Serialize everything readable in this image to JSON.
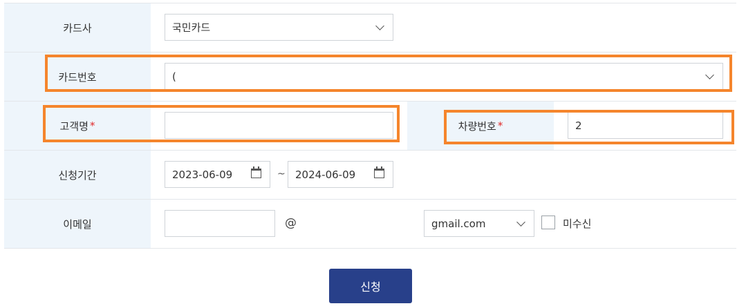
{
  "form": {
    "card_company": {
      "label": "카드사",
      "value": "국민카드"
    },
    "card_number": {
      "label": "카드번호",
      "value": "("
    },
    "customer_name": {
      "label": "고객명",
      "required_mark": "*",
      "value": ""
    },
    "vehicle_number": {
      "label": "차량번호",
      "required_mark": "*",
      "value": "2"
    },
    "period": {
      "label": "신청기간",
      "start": "2023-06-09",
      "separator": "~",
      "end": "2024-06-09"
    },
    "email": {
      "label": "이메일",
      "local_value": "",
      "at": "@",
      "domain_value": "gmail.com",
      "opt_out_label": "미수신"
    }
  },
  "submit": {
    "label": "신청"
  },
  "colors": {
    "highlight": "#f5852c",
    "button": "#28408a",
    "label_bg": "#eef5fb",
    "required": "#e02a2a"
  },
  "icons": [
    "chevron-down-icon",
    "calendar-icon"
  ]
}
